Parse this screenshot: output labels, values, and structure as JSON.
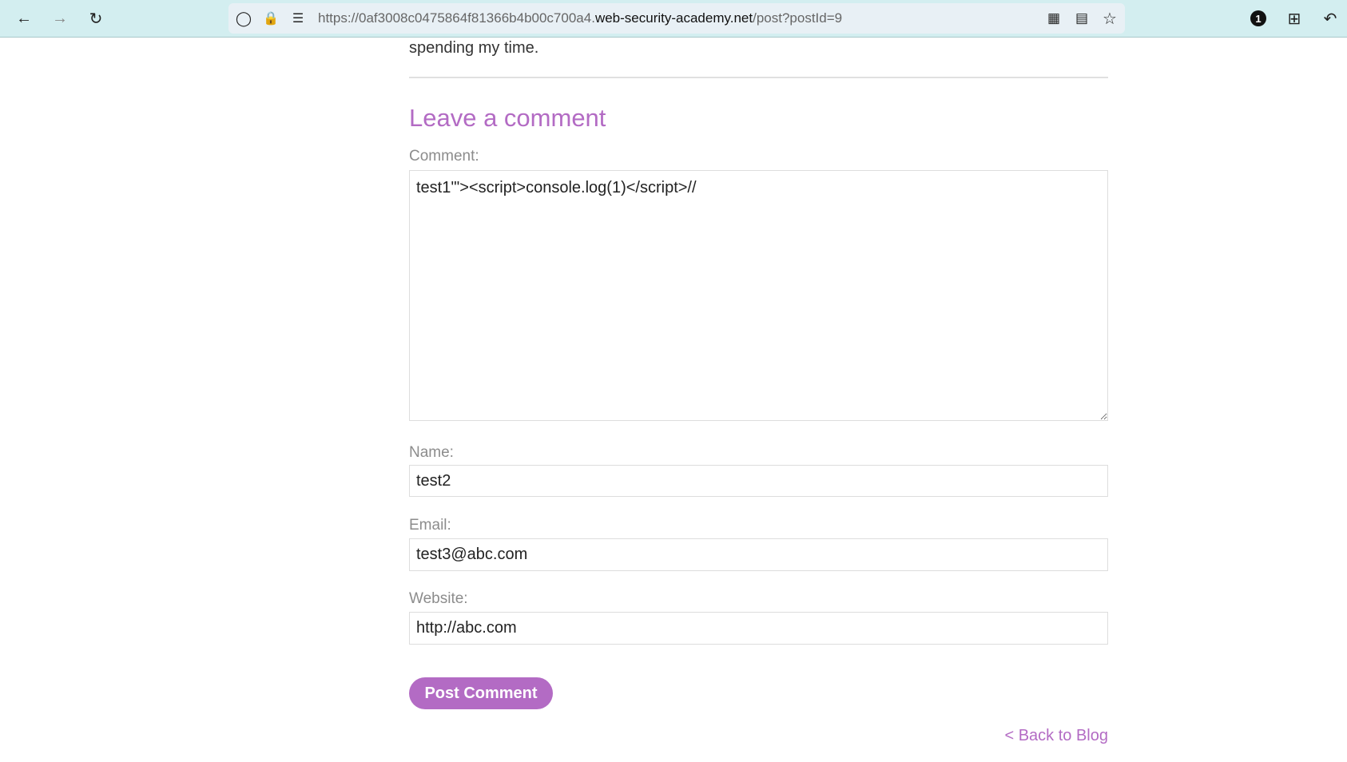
{
  "browser": {
    "url_prefix": "https://0af3008c0475864f81366b4b00c700a4.",
    "url_domain": "web-security-academy.net",
    "url_path": "/post?postId=9",
    "badge": "1"
  },
  "page": {
    "trailing_text": "spending my time.",
    "heading": "Leave a comment",
    "comment_label": "Comment:",
    "comment_value": "test1'\"><script>console.log(1)</script>//",
    "name_label": "Name:",
    "name_value": "test2",
    "email_label": "Email:",
    "email_value": "test3@abc.com",
    "website_label": "Website:",
    "website_value": "http://abc.com",
    "post_button": "Post Comment",
    "back_link": "< Back to Blog"
  }
}
